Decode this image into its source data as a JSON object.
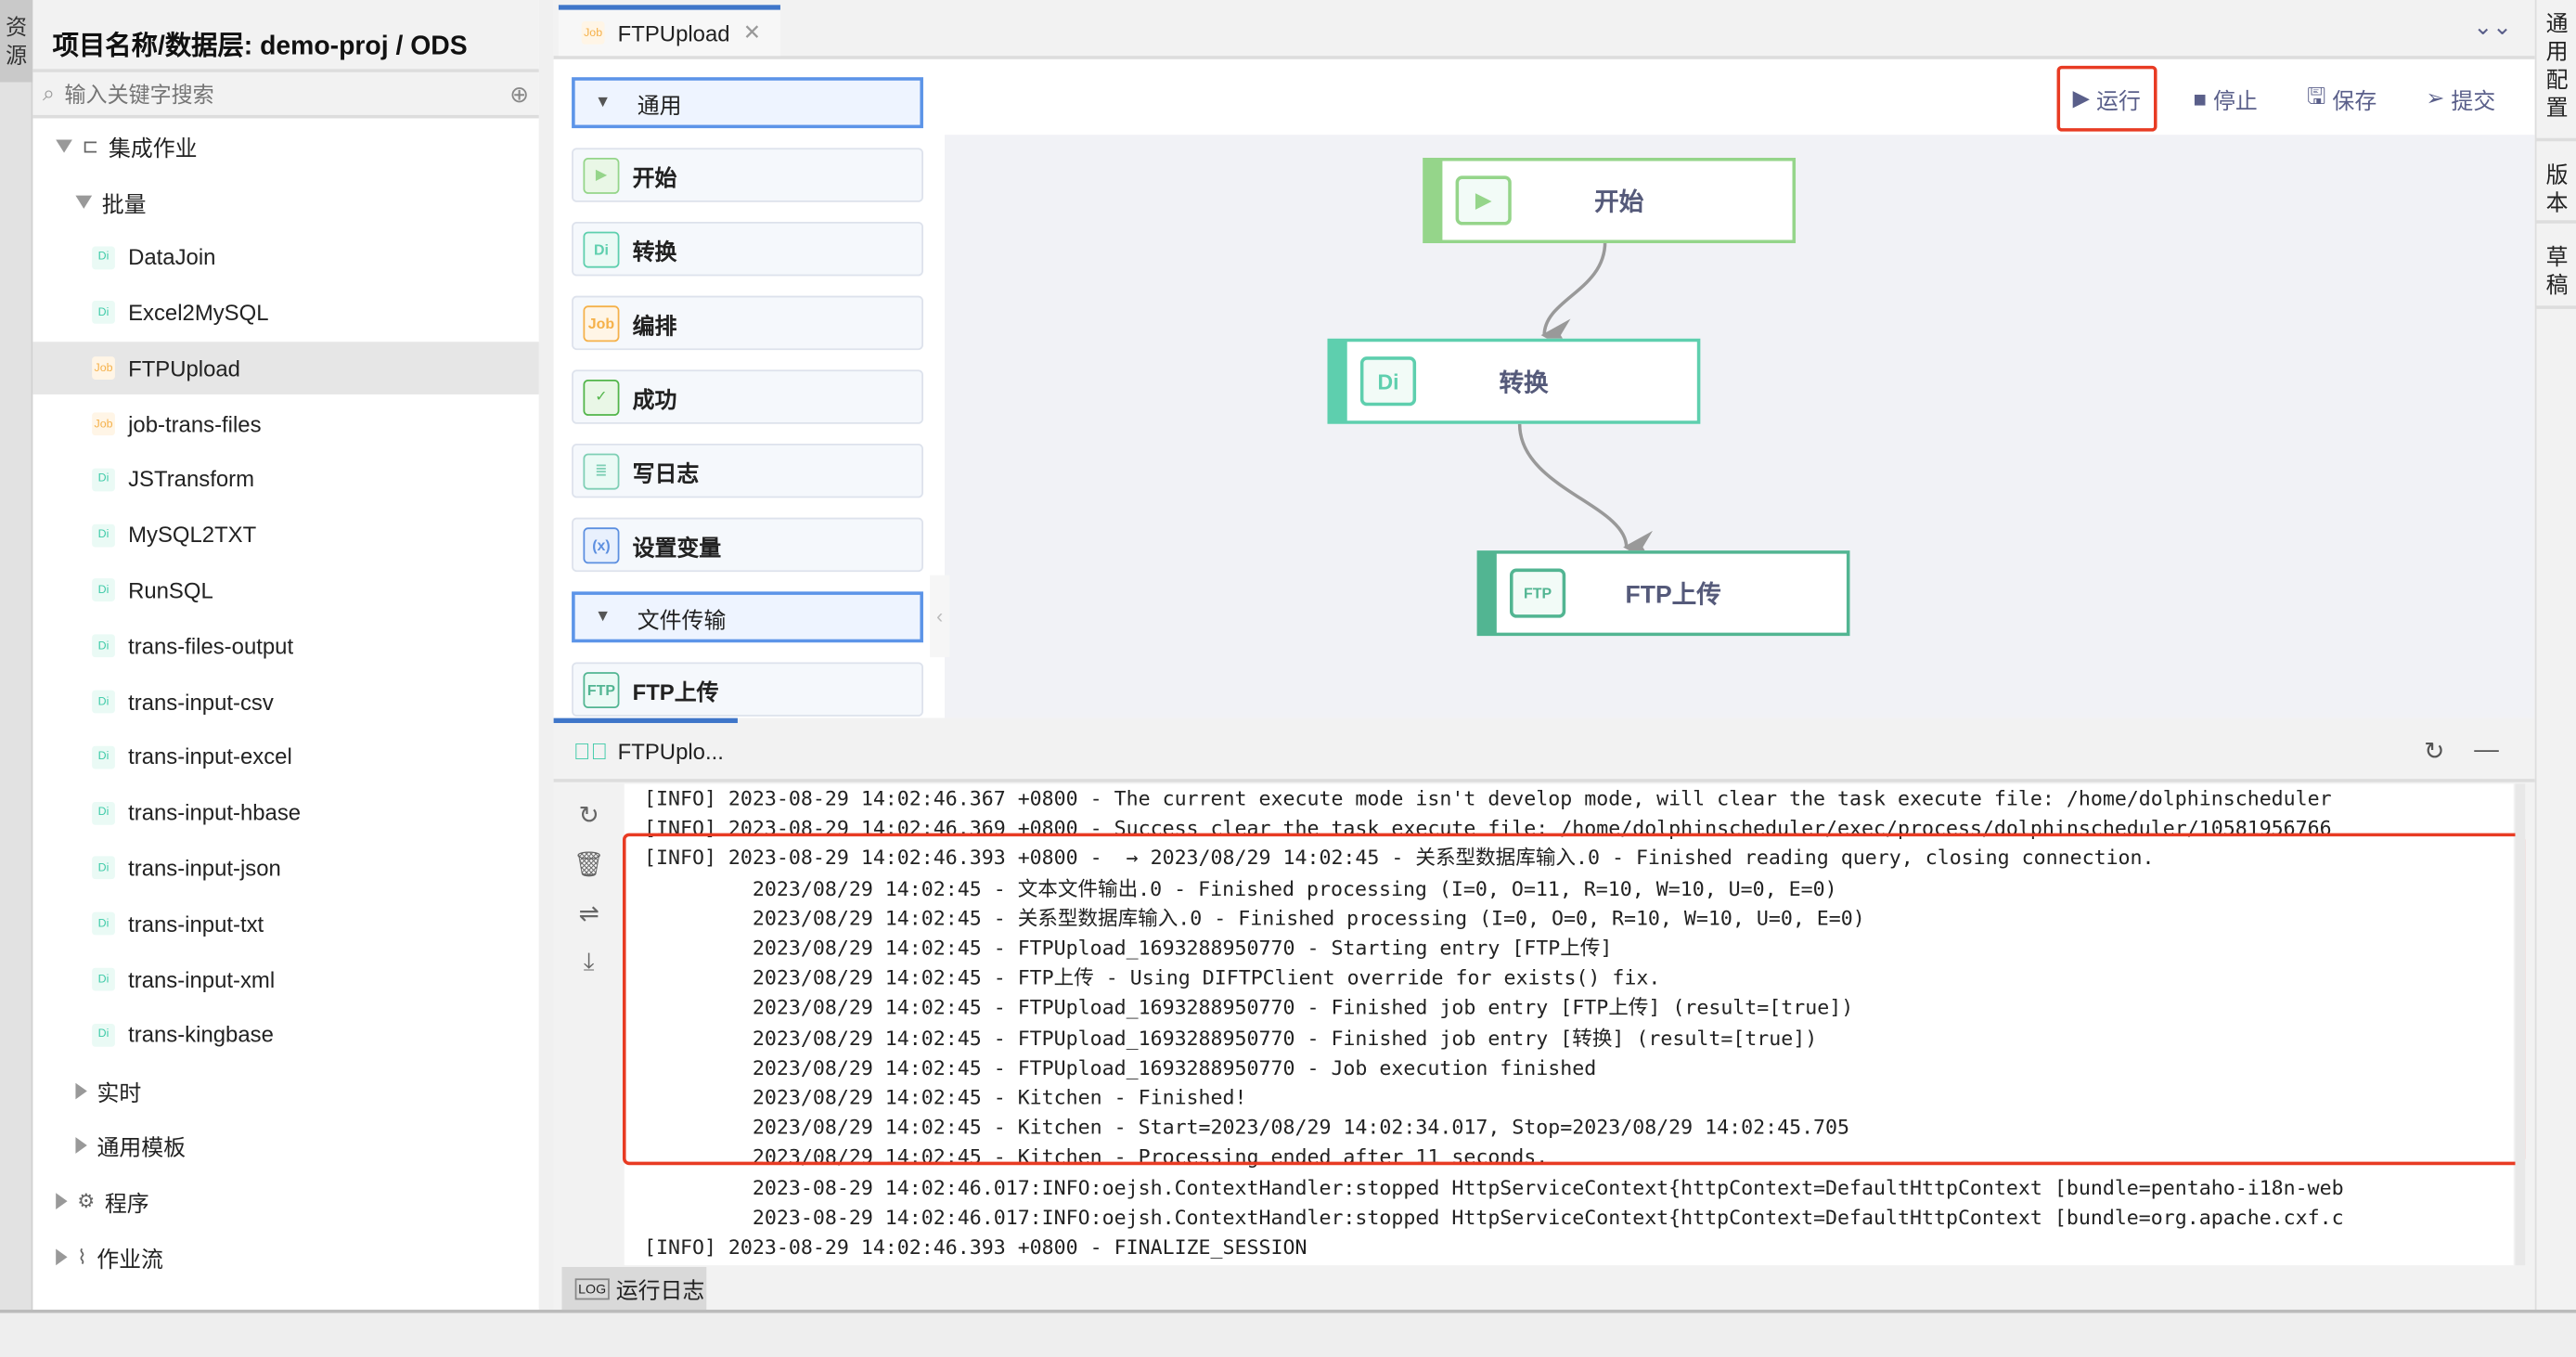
{
  "left_strip": {
    "label": "资源"
  },
  "sidebar": {
    "title": "项目名称/数据层:  demo-proj / ODS",
    "search_placeholder": "输入关键字搜索",
    "tree": [
      {
        "label": "集成作业",
        "level": 0,
        "expanded": true,
        "icon": "integration-icon"
      },
      {
        "label": "批量",
        "level": 1,
        "expanded": true
      },
      {
        "label": "DataJoin",
        "level": 2,
        "type": "Di"
      },
      {
        "label": "Excel2MySQL",
        "level": 2,
        "type": "Di"
      },
      {
        "label": "FTPUpload",
        "level": 2,
        "type": "Job",
        "selected": true
      },
      {
        "label": "job-trans-files",
        "level": 2,
        "type": "Job"
      },
      {
        "label": "JSTransform",
        "level": 2,
        "type": "Di"
      },
      {
        "label": "MySQL2TXT",
        "level": 2,
        "type": "Di"
      },
      {
        "label": "RunSQL",
        "level": 2,
        "type": "Di"
      },
      {
        "label": "trans-files-output",
        "level": 2,
        "type": "Di"
      },
      {
        "label": "trans-input-csv",
        "level": 2,
        "type": "Di"
      },
      {
        "label": "trans-input-excel",
        "level": 2,
        "type": "Di"
      },
      {
        "label": "trans-input-hbase",
        "level": 2,
        "type": "Di"
      },
      {
        "label": "trans-input-json",
        "level": 2,
        "type": "Di"
      },
      {
        "label": "trans-input-txt",
        "level": 2,
        "type": "Di"
      },
      {
        "label": "trans-input-xml",
        "level": 2,
        "type": "Di"
      },
      {
        "label": "trans-kingbase",
        "level": 2,
        "type": "Di"
      },
      {
        "label": "实时",
        "level": 1,
        "expanded": false
      },
      {
        "label": "通用模板",
        "level": 1,
        "expanded": false
      },
      {
        "label": "程序",
        "level": 0,
        "expanded": false,
        "icon": "gear-icon"
      },
      {
        "label": "作业流",
        "level": 0,
        "expanded": false,
        "icon": "workflow-icon"
      }
    ]
  },
  "editor_tab": {
    "badge": "Job",
    "label": "FTPUpload",
    "close": "✕"
  },
  "toolbar": {
    "run": "运行",
    "stop": "停止",
    "save": "保存",
    "submit": "提交"
  },
  "palette": {
    "groups": [
      {
        "label": "通用",
        "items": [
          {
            "label": "开始",
            "badge": "▶"
          },
          {
            "label": "转换",
            "badge": "Di"
          },
          {
            "label": "编排",
            "badge": "Job"
          },
          {
            "label": "成功",
            "badge": "✓"
          },
          {
            "label": "写日志",
            "badge": "≣"
          },
          {
            "label": "设置变量",
            "badge": "(x)"
          }
        ]
      },
      {
        "label": "文件传输",
        "items": [
          {
            "label": "FTP上传",
            "badge": "FTP"
          }
        ]
      }
    ]
  },
  "canvas": {
    "nodes": [
      {
        "label": "开始",
        "badge": "▶",
        "color": "#95d58a"
      },
      {
        "label": "转换",
        "badge": "Di",
        "color": "#5ecfae"
      },
      {
        "label": "FTP上传",
        "badge": "FTP",
        "color": "#52b592"
      }
    ]
  },
  "log_panel": {
    "title": "FTPUplo...",
    "bottom_tab": "运行日志",
    "lines": [
      "[INFO] 2023-08-29 14:02:46.367 +0800 - The current execute mode isn't develop mode, will clear the task execute file: /home/dolphinscheduler",
      "[INFO] 2023-08-29 14:02:46.369 +0800 - Success clear the task execute file: /home/dolphinscheduler/exec/process/dolphinscheduler/10581956766",
      "[INFO] 2023-08-29 14:02:46.393 +0800 -  → 2023/08/29 14:02:45 - 关系型数据库输入.0 - Finished reading query, closing connection.",
      "         2023/08/29 14:02:45 - 文本文件输出.0 - Finished processing (I=0, O=11, R=10, W=10, U=0, E=0)",
      "         2023/08/29 14:02:45 - 关系型数据库输入.0 - Finished processing (I=0, O=0, R=10, W=10, U=0, E=0)",
      "         2023/08/29 14:02:45 - FTPUpload_1693288950770 - Starting entry [FTP上传]",
      "         2023/08/29 14:02:45 - FTP上传 - Using DIFTPClient override for exists() fix.",
      "         2023/08/29 14:02:45 - FTPUpload_1693288950770 - Finished job entry [FTP上传] (result=[true])",
      "         2023/08/29 14:02:45 - FTPUpload_1693288950770 - Finished job entry [转换] (result=[true])",
      "         2023/08/29 14:02:45 - FTPUpload_1693288950770 - Job execution finished",
      "         2023/08/29 14:02:45 - Kitchen - Finished!",
      "         2023/08/29 14:02:45 - Kitchen - Start=2023/08/29 14:02:34.017, Stop=2023/08/29 14:02:45.705",
      "         2023/08/29 14:02:45 - Kitchen - Processing ended after 11 seconds.",
      "         2023-08-29 14:02:46.017:INFO:oejsh.ContextHandler:stopped HttpServiceContext{httpContext=DefaultHttpContext [bundle=pentaho-i18n-web",
      "         2023-08-29 14:02:46.017:INFO:oejsh.ContextHandler:stopped HttpServiceContext{httpContext=DefaultHttpContext [bundle=org.apache.cxf.c",
      "[INFO] 2023-08-29 14:02:46.393 +0800 - FINALIZE_SESSION"
    ]
  },
  "right_strip": {
    "tabs": [
      "通用配置",
      "版本",
      "草稿"
    ]
  },
  "colors": {
    "accent": "#3f76c9",
    "highlight": "#e83b23",
    "toolbar_text": "#5a5f8a"
  }
}
